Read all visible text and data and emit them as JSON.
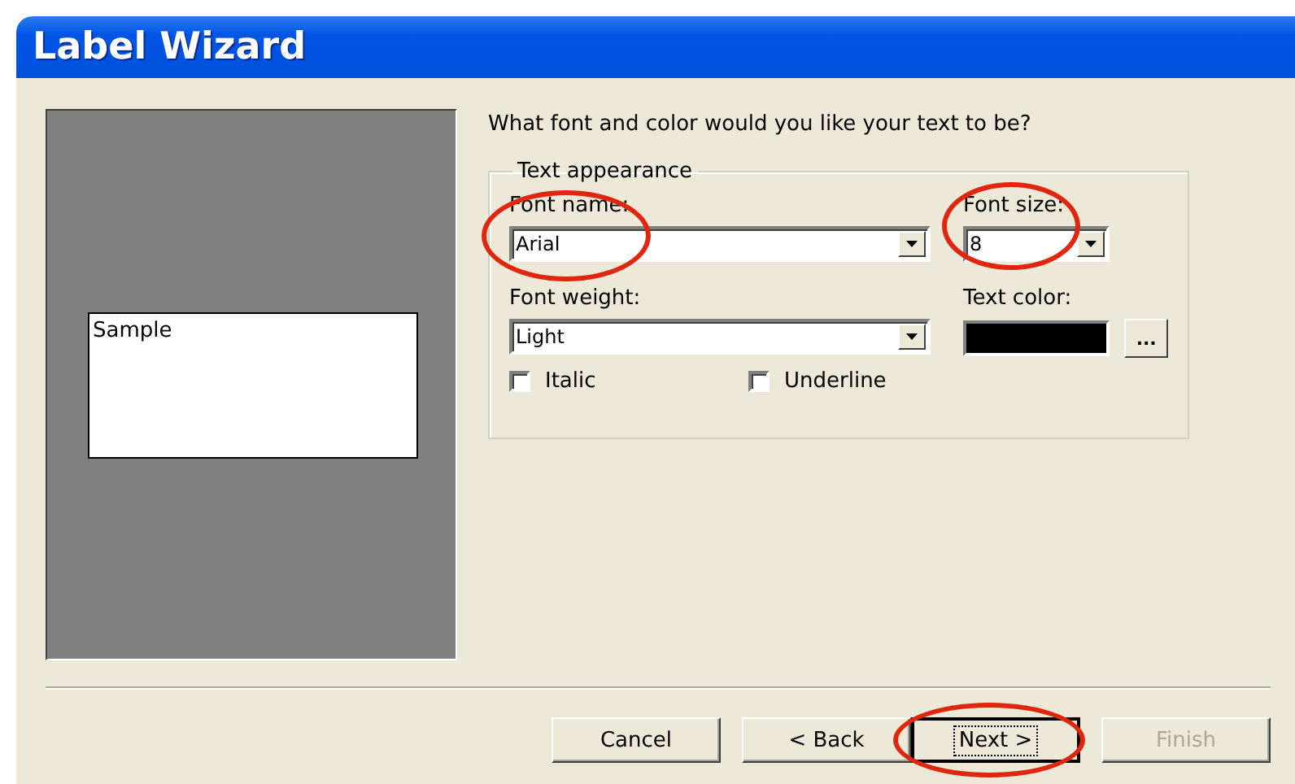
{
  "window": {
    "title": "Label Wizard"
  },
  "preview": {
    "sample_text": "Sample"
  },
  "prompt": "What font and color would you like your text to be?",
  "group": {
    "legend": "Text appearance",
    "font_name": {
      "label": "Font name:",
      "value": "Arial",
      "circled": true
    },
    "font_size": {
      "label": "Font size:",
      "value": "8",
      "circled": true
    },
    "font_weight": {
      "label": "Font weight:",
      "value": "Light",
      "circled": false
    },
    "text_color": {
      "label": "Text color:",
      "color": "#000000",
      "button": "..."
    },
    "checkboxes": [
      {
        "label": "Italic",
        "checked": false
      },
      {
        "label": "Underline",
        "checked": false
      }
    ]
  },
  "buttons": [
    {
      "label": "Cancel",
      "default": false,
      "disabled": false,
      "circled": false
    },
    {
      "label": "< Back",
      "default": false,
      "disabled": false,
      "circled": false
    },
    {
      "label": "Next >",
      "default": true,
      "disabled": false,
      "circled": true
    },
    {
      "label": "Finish",
      "default": false,
      "disabled": true,
      "circled": false
    }
  ]
}
